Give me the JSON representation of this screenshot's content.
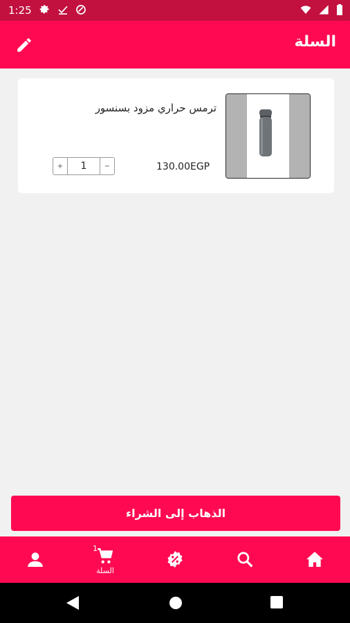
{
  "status_bar": {
    "time": "1:25"
  },
  "app_bar": {
    "title": "السلة"
  },
  "cart_item": {
    "name": "ترمس حراري مزود بسنسور",
    "price": "130.00EGP",
    "quantity": "1",
    "plus": "+",
    "minus": "−"
  },
  "checkout": {
    "label": "الذهاب إلى الشراء"
  },
  "bottom_nav": {
    "cart_label": "السلة",
    "cart_badge": "1"
  },
  "colors": {
    "accent": "#ff0a52",
    "status": "#c2103f"
  }
}
